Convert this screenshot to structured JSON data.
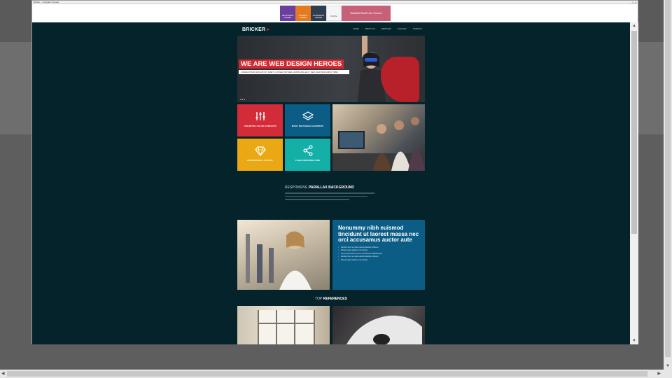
{
  "popup": {
    "title": "Bricker – Template Preview",
    "controls": "_ □ ×"
  },
  "ads": {
    "ad1": "RESPONSIVE THEMES",
    "ad2": "MAGENTO THEMES",
    "ad3": "WORDPRESS THEMES",
    "ad4": "DIGITAL",
    "ad5": "Beautiful WordPress Themes"
  },
  "site": {
    "logo": "BRICKER",
    "logo_mark": "▸",
    "nav": [
      "HOME",
      "ABOUT US",
      "SERVICES",
      "GALLERY",
      "CONTACT"
    ],
    "hero_title": "WE ARE WEB DESIGN HEROES",
    "hero_subtitle": "LOREM IPSUM DOLOR SIT AMET, CONSECTETUER ADIPISCING ELIT, SED DIAM NONUMMY NIBH",
    "hero_dots": "● ● ●",
    "tiles": {
      "t1": "UNLIMITED COLOR VARIANTS",
      "t2": "MANY REUSABLE ELEMENTS",
      "t3": "RESPONSIVE LAYOUTS",
      "t4": "CLEAN MODERN CODE"
    },
    "parallax": {
      "light": "RESPONSIVE",
      "bold": "PARALLAX BACKGROUND"
    },
    "business": {
      "title": "Nonummy nibh euismod tincidunt ut laoreet massa nec orci accusamus auctor aute",
      "items": [
        "Facilisis nunc nec diam euismod facilisis ut laoreet",
        "Massa magna aliquam erat volutpat",
        "Lorem ipsum dolor sit amet, consectetuer adipiscing elit",
        "Facilisis nunc nec diam euismod facilisis ut laoreet",
        "Massa magna aliquam erat volutpat"
      ]
    },
    "refs": {
      "light": "TOP",
      "bold": "REFERENCES"
    }
  },
  "scroll": {
    "up": "▲",
    "down": "▼",
    "left": "◀",
    "right": "▶"
  }
}
